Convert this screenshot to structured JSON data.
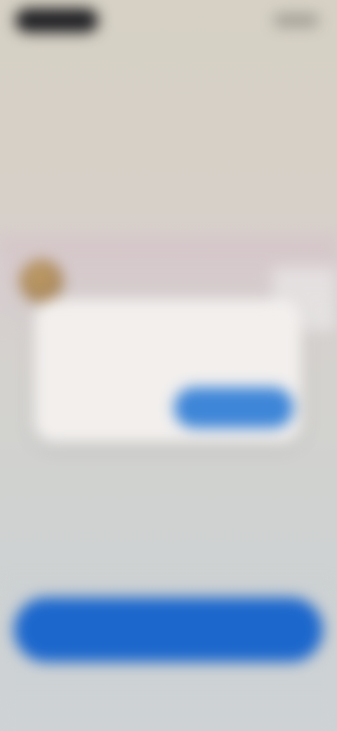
{
  "toast": {
    "title": "",
    "avatar_icon": "avatar-icon"
  },
  "dialog": {
    "message": "",
    "secondary_label": "",
    "primary_label": ""
  },
  "content": {
    "heading": "",
    "description": ""
  },
  "footer": {
    "action_label": ""
  },
  "colors": {
    "primary_blue": "#1c67cc",
    "dialog_blue": "#3e86d8",
    "accent_red": "#b14f55"
  }
}
